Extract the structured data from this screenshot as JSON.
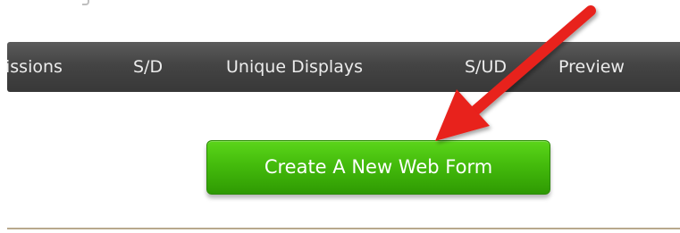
{
  "header": {
    "columns": [
      "issions",
      "S/D",
      "Unique Displays",
      "S/UD",
      "Preview"
    ]
  },
  "main": {
    "create_button_label": "Create A New Web Form"
  },
  "annotation": {
    "arrow_color": "#e8201c",
    "arrow_icon": "red-arrow-pointer"
  },
  "colors": {
    "header_bg": "#444444",
    "button_green": "#44bb0c",
    "divider": "#b8a88c"
  }
}
